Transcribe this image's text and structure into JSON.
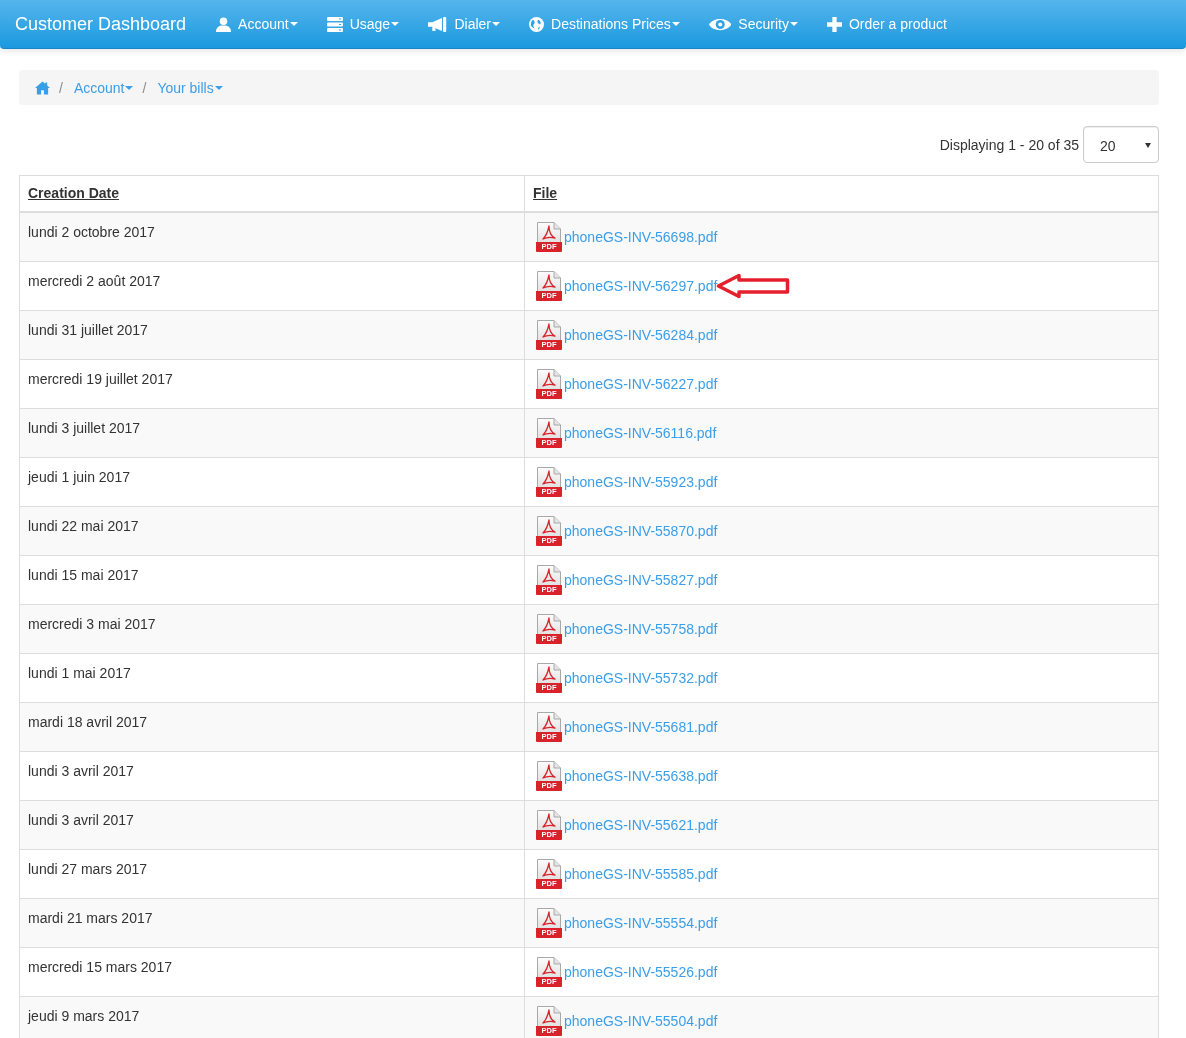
{
  "navbar": {
    "brand": "Customer Dashboard",
    "items": [
      {
        "label": "Account",
        "kind": "user",
        "dropdown": true
      },
      {
        "label": "Usage",
        "kind": "server",
        "dropdown": true
      },
      {
        "label": "Dialer",
        "kind": "megaphone",
        "dropdown": true
      },
      {
        "label": "Destinations Prices",
        "kind": "globe",
        "dropdown": true
      },
      {
        "label": "Security",
        "kind": "eye",
        "dropdown": true
      },
      {
        "label": "Order a product",
        "kind": "plus",
        "dropdown": false
      }
    ]
  },
  "breadcrumb": {
    "items": [
      {
        "separator": "/",
        "label": "Account",
        "dropdown": true
      },
      {
        "separator": "/",
        "label": "Your bills",
        "dropdown": true
      }
    ]
  },
  "pagination": {
    "summary": "Displaying 1 - 20 of 35",
    "page_size": "20"
  },
  "table": {
    "columns": [
      "Creation Date",
      "File"
    ],
    "rows": [
      {
        "date": "lundi 2 octobre 2017",
        "file": "phoneGS-INV-56698.pdf",
        "icon_label": "PDF",
        "marked": false
      },
      {
        "date": "mercredi 2 août 2017",
        "file": "phoneGS-INV-56297.pdf",
        "icon_label": "PDF",
        "marked": true
      },
      {
        "date": "lundi 31 juillet 2017",
        "file": "phoneGS-INV-56284.pdf",
        "icon_label": "PDF",
        "marked": false
      },
      {
        "date": "mercredi 19 juillet 2017",
        "file": "phoneGS-INV-56227.pdf",
        "icon_label": "PDF",
        "marked": false
      },
      {
        "date": "lundi 3 juillet 2017",
        "file": "phoneGS-INV-56116.pdf",
        "icon_label": "PDF",
        "marked": false
      },
      {
        "date": "jeudi 1 juin 2017",
        "file": "phoneGS-INV-55923.pdf",
        "icon_label": "PDF",
        "marked": false
      },
      {
        "date": "lundi 22 mai 2017",
        "file": "phoneGS-INV-55870.pdf",
        "icon_label": "PDF",
        "marked": false
      },
      {
        "date": "lundi 15 mai 2017",
        "file": "phoneGS-INV-55827.pdf",
        "icon_label": "PDF",
        "marked": false
      },
      {
        "date": "mercredi 3 mai 2017",
        "file": "phoneGS-INV-55758.pdf",
        "icon_label": "PDF",
        "marked": false
      },
      {
        "date": "lundi 1 mai 2017",
        "file": "phoneGS-INV-55732.pdf",
        "icon_label": "PDF",
        "marked": false
      },
      {
        "date": "mardi 18 avril 2017",
        "file": "phoneGS-INV-55681.pdf",
        "icon_label": "PDF",
        "marked": false
      },
      {
        "date": "lundi 3 avril 2017",
        "file": "phoneGS-INV-55638.pdf",
        "icon_label": "PDF",
        "marked": false
      },
      {
        "date": "lundi 3 avril 2017",
        "file": "phoneGS-INV-55621.pdf",
        "icon_label": "PDF",
        "marked": false
      },
      {
        "date": "lundi 27 mars 2017",
        "file": "phoneGS-INV-55585.pdf",
        "icon_label": "PDF",
        "marked": false
      },
      {
        "date": "mardi 21 mars 2017",
        "file": "phoneGS-INV-55554.pdf",
        "icon_label": "PDF",
        "marked": false
      },
      {
        "date": "mercredi 15 mars 2017",
        "file": "phoneGS-INV-55526.pdf",
        "icon_label": "PDF",
        "marked": false
      },
      {
        "date": "jeudi 9 mars 2017",
        "file": "phoneGS-INV-55504.pdf",
        "icon_label": "PDF",
        "marked": false
      }
    ]
  }
}
